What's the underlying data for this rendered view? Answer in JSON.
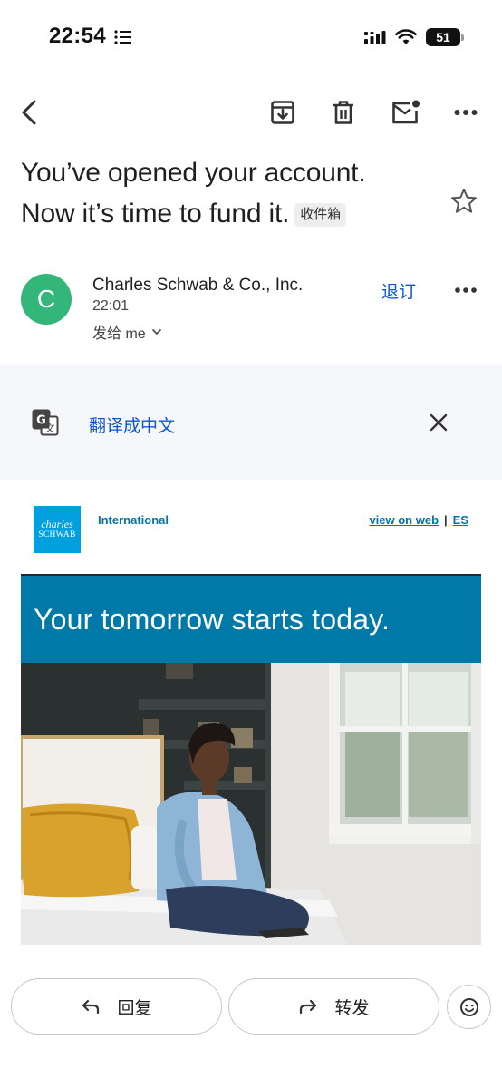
{
  "status_bar": {
    "time": "22:54",
    "battery": "51"
  },
  "toolbar": {
    "icons": [
      "back-icon",
      "archive-icon",
      "delete-icon",
      "mark-unread-icon",
      "more-icon"
    ]
  },
  "email": {
    "subject_line1": "You’ve opened your account.",
    "subject_line2": "Now it’s time to fund it.",
    "label_chip": "收件箱",
    "sender": {
      "avatar_letter": "C",
      "avatar_color": "#33b679",
      "name": "Charles Schwab & Co., Inc.",
      "time": "22:01",
      "to": "发给 me",
      "unsubscribe": "退订"
    }
  },
  "translate": {
    "label": "翻译成中文"
  },
  "body": {
    "logo_line1": "charles",
    "logo_line2": "SCHWAB",
    "international": "International",
    "view_on_web": "view on web",
    "separator": "|",
    "es": "ES",
    "hero_text": "Your tomorrow starts today.",
    "colors": {
      "brand_blue": "#00a0df",
      "hero_blue": "#0078a8",
      "link_blue": "#0073a8"
    }
  },
  "actions": {
    "reply": "回复",
    "forward": "转发"
  }
}
